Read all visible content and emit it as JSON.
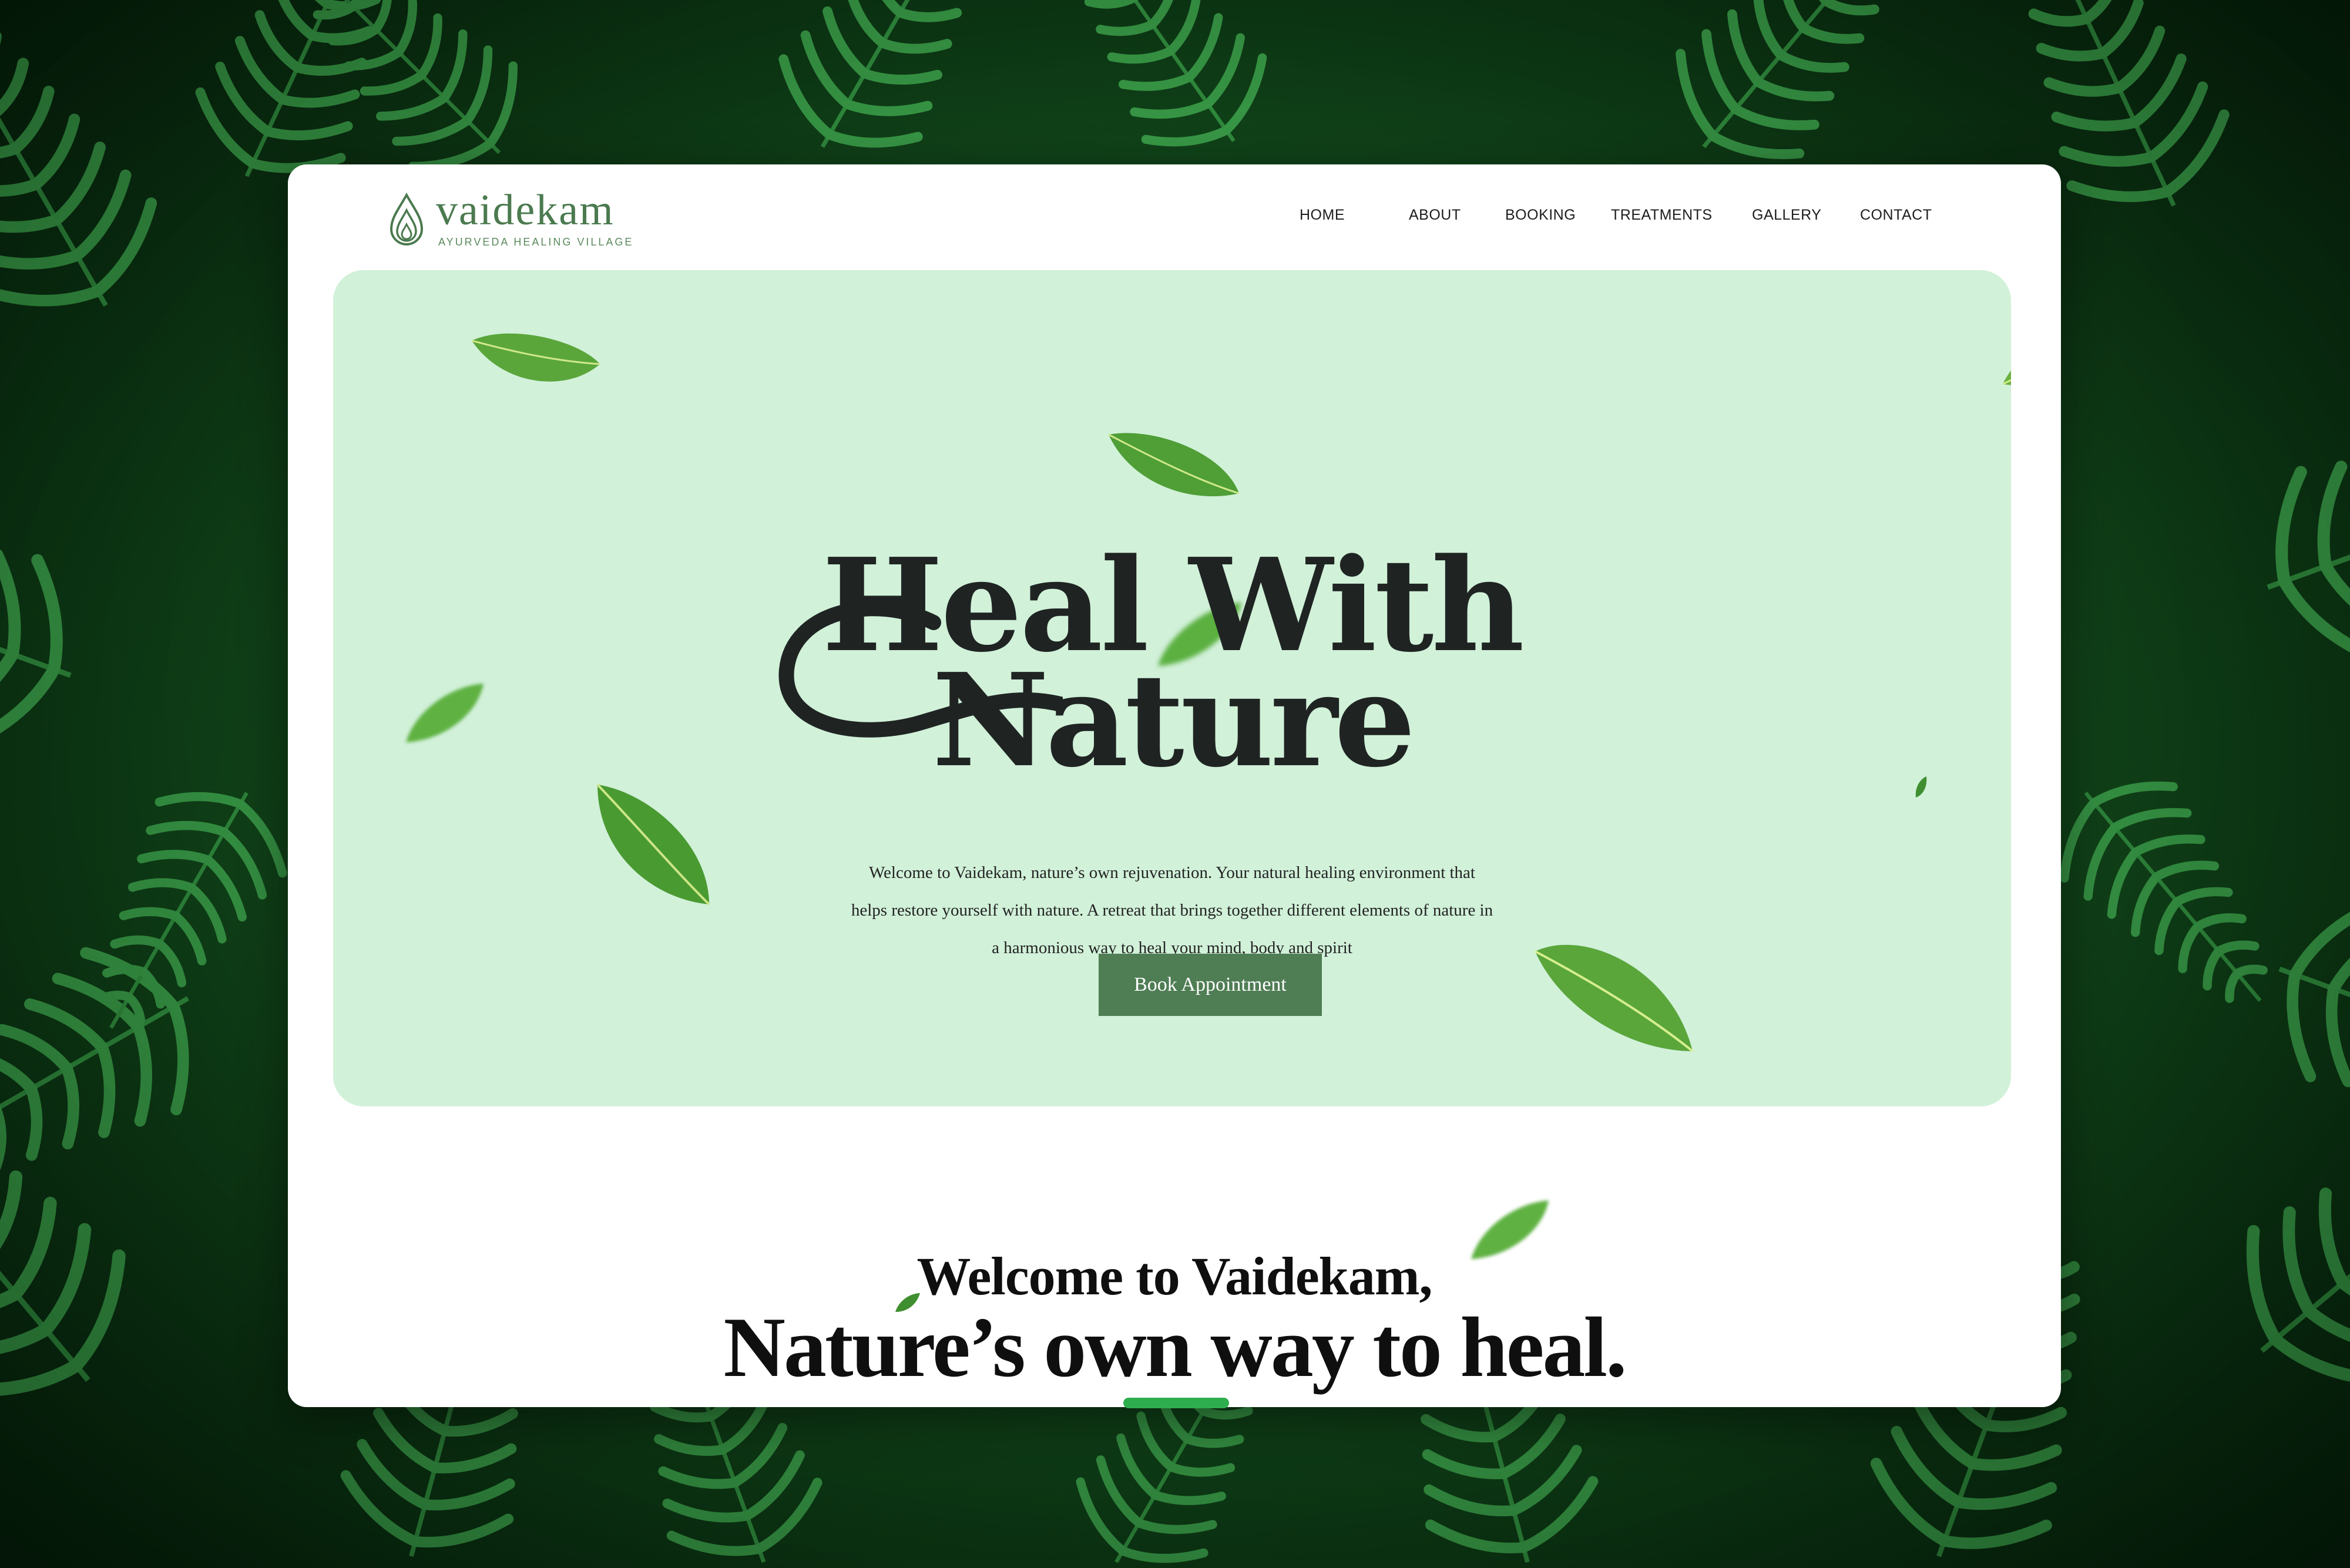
{
  "brand": {
    "name": "vaidekam",
    "tagline": "AYURVEDA HEALING VILLAGE",
    "color": "#4b7a4f"
  },
  "nav": {
    "items": [
      "HOME",
      "ABOUT",
      "BOOKING",
      "TREATMENTS",
      "GALLERY",
      "CONTACT"
    ]
  },
  "hero": {
    "title_line1": "Heal With",
    "title_line2": "Nature",
    "description": [
      "Welcome to Vaidekam, nature’s own rejuvenation. Your natural healing environment that",
      "helps restore yourself with nature. A retreat that brings together different elements of nature in",
      "a harmonious way to heal your mind, body and spirit"
    ],
    "cta_label": "Book Appointment",
    "background": "#d1f1d9",
    "cta_color": "#4f7d54"
  },
  "welcome": {
    "line1": "Welcome to Vaidekam,",
    "line2": "Nature’s own way to heal."
  },
  "icons": [
    "water-drop-logo-icon",
    "leaf-icon"
  ]
}
